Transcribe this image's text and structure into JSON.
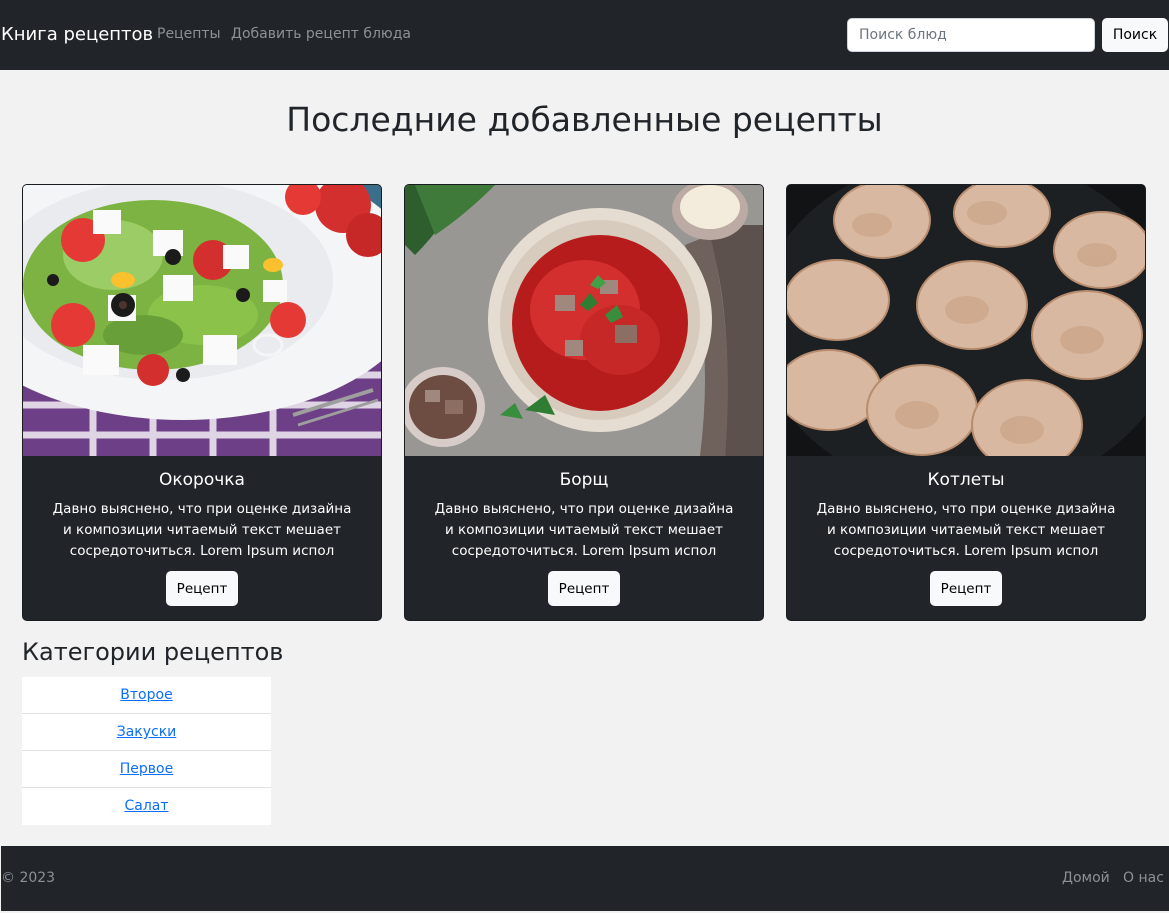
{
  "navbar": {
    "brand": "Книга рецептов",
    "links": [
      "Рецепты",
      "Добавить рецепт блюда"
    ],
    "search_placeholder": "Поиск блюд",
    "search_button": "Поиск"
  },
  "page_title": "Последние добавленные рецепты",
  "cards": [
    {
      "title": "Окорочка",
      "text": "Давно выяснено, что при оценке дизайна и композиции читаемый текст мешает сосредоточиться. Lorem Ipsum испол",
      "button": "Рецепт",
      "image": "greek-salad-photo"
    },
    {
      "title": "Борщ",
      "text": "Давно выяснено, что при оценке дизайна и композиции читаемый текст мешает сосредоточиться. Lorem Ipsum испол",
      "button": "Рецепт",
      "image": "borscht-photo"
    },
    {
      "title": "Котлеты",
      "text": "Давно выяснено, что при оценке дизайна и композиции читаемый текст мешает сосредоточиться. Lorem Ipsum испол",
      "button": "Рецепт",
      "image": "cutlets-photo"
    }
  ],
  "categories": {
    "heading": "Категории рецептов",
    "items": [
      "Второе",
      "Закуски",
      "Первое",
      "Салат"
    ]
  },
  "footer": {
    "copyright": "© 2023",
    "links": [
      "Домой",
      "О нас"
    ]
  },
  "colors": {
    "navbar_bg": "#212529",
    "page_bg": "#f2f2f2",
    "card_bg": "#212529",
    "link": "#0d6efd",
    "muted": "#8c9197"
  }
}
